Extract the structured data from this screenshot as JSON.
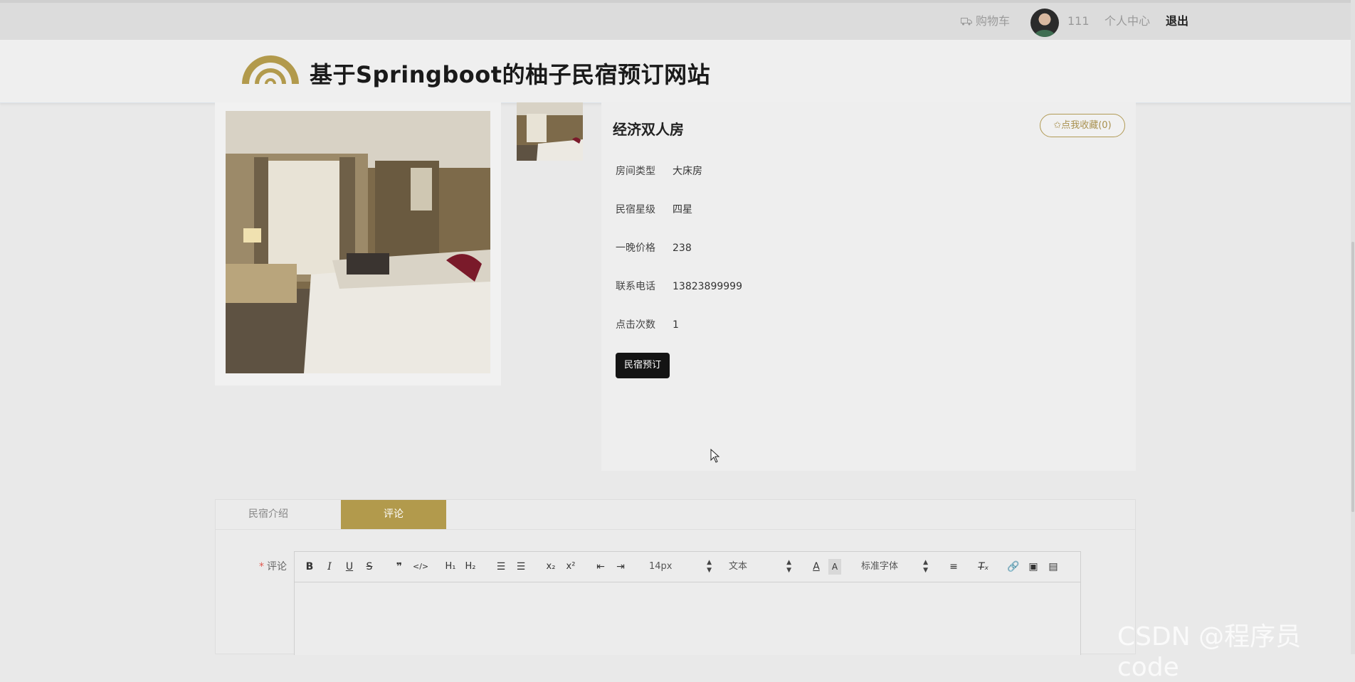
{
  "topbar": {
    "cart_label": "购物车",
    "username": "111",
    "center_label": "个人中心",
    "logout_label": "退出"
  },
  "header": {
    "site_title": "基于Springboot的柚子民宿预订网站"
  },
  "room": {
    "name": "经济双人房",
    "fav_label": "✩点我收藏(0)",
    "fields": [
      {
        "key": "房间类型",
        "value": "大床房"
      },
      {
        "key": "民宿星级",
        "value": "四星"
      },
      {
        "key": "一晚价格",
        "value": "238"
      },
      {
        "key": "联系电话",
        "value": "13823899999"
      },
      {
        "key": "点击次数",
        "value": "1"
      }
    ],
    "book_label": "民宿预订"
  },
  "tabs": [
    {
      "label": "民宿介绍",
      "active": false
    },
    {
      "label": "评论",
      "active": true
    }
  ],
  "comment": {
    "required_mark": "*",
    "label": "评论"
  },
  "editor": {
    "font_size": "14px",
    "header_select": "文本",
    "font_family": "标准字体"
  },
  "watermark": "CSDN @程序员code",
  "colors": {
    "accent": "#b29a4c",
    "book_button": "#141414",
    "topbar": "#dcdcdc"
  }
}
